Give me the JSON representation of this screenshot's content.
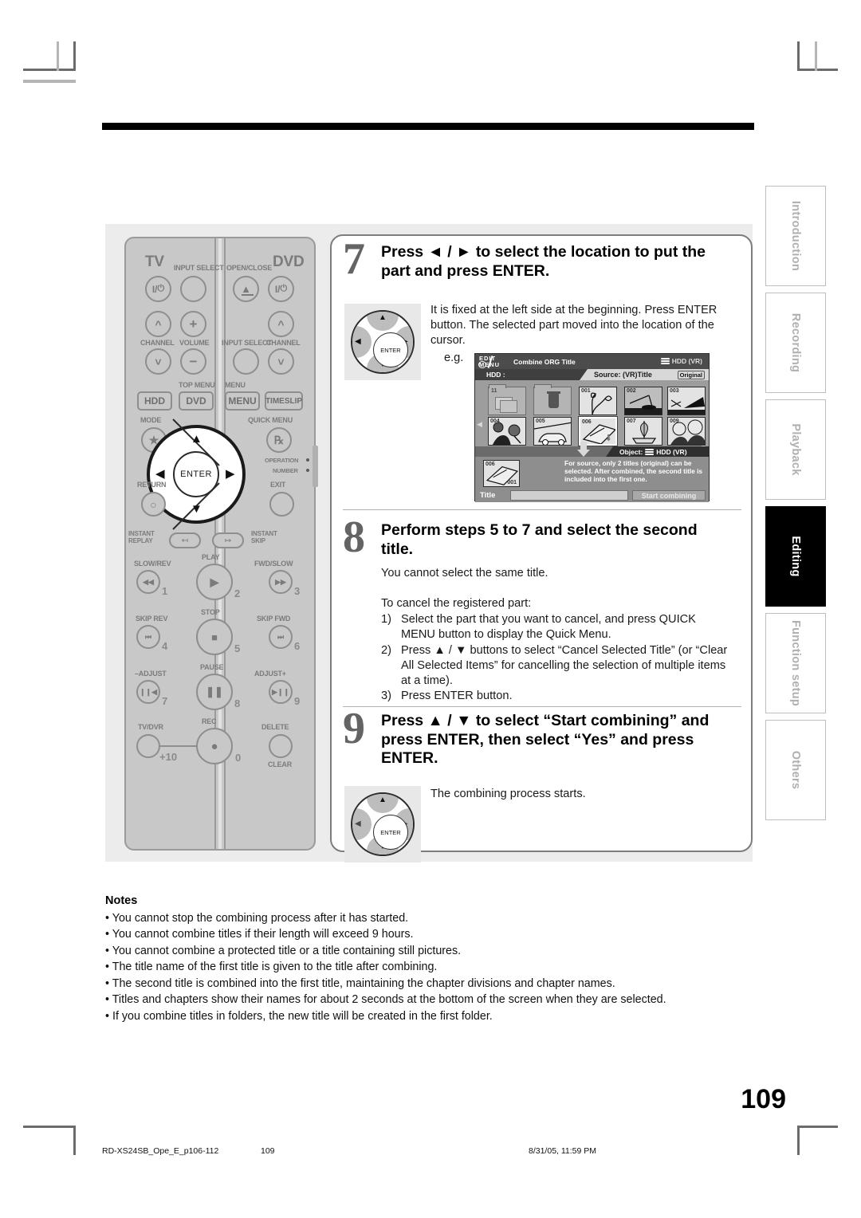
{
  "page": {
    "number": "109",
    "footer_left": "RD-XS24SB_Ope_E_p106-112",
    "footer_page": "109",
    "footer_right": "8/31/05, 11:59 PM"
  },
  "side_tabs": [
    {
      "label": "Introduction",
      "active": false
    },
    {
      "label": "Recording",
      "active": false
    },
    {
      "label": "Playback",
      "active": false
    },
    {
      "label": "Editing",
      "active": true
    },
    {
      "label": "Function setup",
      "active": false
    },
    {
      "label": "Others",
      "active": false
    }
  ],
  "steps": [
    {
      "number": "7",
      "heading": "Press ◄ / ► to select the location to put the part and press ENTER.",
      "body": "It is fixed at the left side at the beginning. Press ENTER button. The selected part moved into the location of the cursor.",
      "eg_label": "e.g."
    },
    {
      "number": "8",
      "heading": "Perform steps 5 to 7 and select the second title.",
      "body1": "You cannot select the same title.",
      "body2": "To cancel the registered part:",
      "list": [
        {
          "marker": "1)",
          "text": "Select the part that you want to cancel, and press QUICK MENU button to display the Quick Menu."
        },
        {
          "marker": "2)",
          "text": "Press ▲ / ▼ buttons to select “Cancel Selected Title” (or “Clear All Selected Items” for cancelling the selection of multiple items at a time)."
        },
        {
          "marker": "3)",
          "text": "Press ENTER button."
        }
      ]
    },
    {
      "number": "9",
      "heading": "Press ▲ / ▼ to select “Start combining” and press ENTER, then select “Yes” and press ENTER.",
      "body": "The combining process starts."
    }
  ],
  "tv_screen": {
    "logo_line1": "EDIT",
    "logo_line2": "MENU",
    "title": "Combine ORG Title",
    "device": "HDD (VR)",
    "hdd_label": "HDD :",
    "source_label": "Source: (VR)Title",
    "original_badge": "Original",
    "folder_count": "11",
    "thumbnails": [
      {
        "id": "001",
        "selected": false
      },
      {
        "id": "002",
        "selected": false
      },
      {
        "id": "003",
        "selected": false
      },
      {
        "id": "004",
        "selected": false
      },
      {
        "id": "005",
        "selected": false
      },
      {
        "id": "006",
        "selected": true
      },
      {
        "id": "007",
        "selected": false
      },
      {
        "id": "009",
        "selected": false
      }
    ],
    "object_label": "Object:",
    "object_device": "HDD (VR)",
    "object_thumb_id": "006",
    "object_thumb_sub": "001",
    "note": "For source, only 2 titles (original) can be selected.  After combined, the second title is included into the first one.",
    "title_field_label": "Title",
    "title_field_value": "",
    "start_button": "Start combining"
  },
  "remote": {
    "labels": {
      "tv": "TV",
      "dvd": "DVD",
      "input_select": "INPUT SELECT",
      "open_close": "OPEN/CLOSE",
      "channel": "CHANNEL",
      "volume": "VOLUME",
      "input_select2": "INPUT SELECT",
      "channel2": "CHANNEL",
      "top_menu": "TOP MENU",
      "menu": "MENU",
      "hdd": "HDD",
      "dvd_btn": "DVD",
      "menu_btn": "MENU",
      "timeslip": "TIMESLIP",
      "mode": "MODE",
      "quick_menu": "QUICK MENU",
      "enter": "ENTER",
      "return": "RETURN",
      "exit": "EXIT",
      "operation": "OPERATION",
      "number": "NUMBER",
      "instant_replay": "INSTANT\nREPLAY",
      "instant_skip": "INSTANT\nSKIP",
      "slow_rev": "SLOW/REV",
      "play": "PLAY",
      "fwd_slow": "FWD/SLOW",
      "skip_rev": "SKIP REV",
      "stop": "STOP",
      "skip_fwd": "SKIP FWD",
      "adjust_minus": "–ADJUST",
      "pause": "PAUSE",
      "adjust_plus": "ADJUST+",
      "tv_dvr": "TV/DVR",
      "rec": "REC",
      "delete": "DELETE",
      "clear": "CLEAR"
    },
    "numbers": {
      "n1": "1",
      "n2": "2",
      "n3": "3",
      "n4": "4",
      "n5": "5",
      "n6": "6",
      "n7": "7",
      "n8": "8",
      "n9": "9",
      "n10": "+10",
      "n0": "0"
    }
  },
  "notes": {
    "title": "Notes",
    "items": [
      "You cannot stop the combining process after it has started.",
      "You cannot combine titles if their length will exceed 9 hours.",
      "You cannot combine a protected title or a title containing still pictures.",
      "The title name of the first title is given to the title after combining.",
      "The second title is combined into the first title, maintaining the chapter divisions and chapter names.",
      "Titles and chapters show their names for about 2 seconds at the bottom of the screen when they are selected.",
      "If you combine titles in folders, the new title will be created in the first folder."
    ]
  }
}
